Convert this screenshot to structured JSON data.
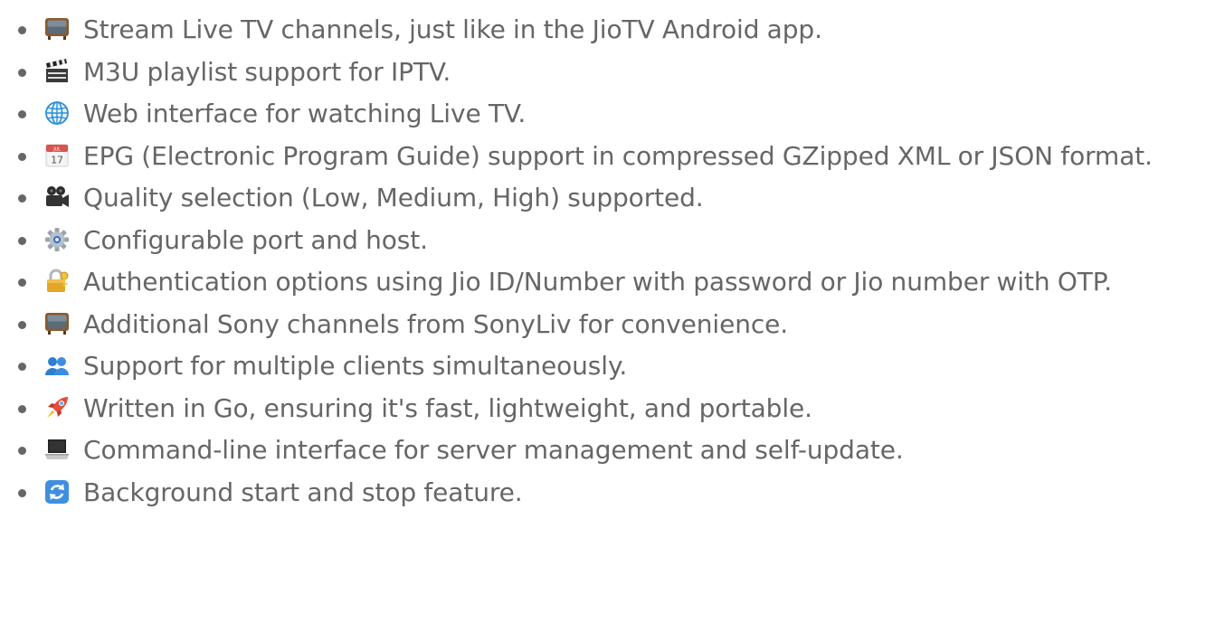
{
  "features": [
    {
      "icon": "television-icon",
      "text": "Stream Live TV channels, just like in the JioTV Android app."
    },
    {
      "icon": "clapper-board-icon",
      "text": "M3U playlist support for IPTV."
    },
    {
      "icon": "globe-icon",
      "text": "Web interface for watching Live TV."
    },
    {
      "icon": "calendar-icon",
      "text": "EPG (Electronic Program Guide) support in compressed GZipped XML or JSON format."
    },
    {
      "icon": "movie-camera-icon",
      "text": "Quality selection (Low, Medium, High) supported."
    },
    {
      "icon": "gear-icon",
      "text": "Configurable port and host."
    },
    {
      "icon": "lock-key-icon",
      "text": "Authentication options using Jio ID/Number with password or Jio number with OTP."
    },
    {
      "icon": "television-icon",
      "text": "Additional Sony channels from SonyLiv for convenience."
    },
    {
      "icon": "busts-icon",
      "text": "Support for multiple clients simultaneously."
    },
    {
      "icon": "rocket-icon",
      "text": "Written in Go, ensuring it's fast, lightweight, and portable."
    },
    {
      "icon": "laptop-icon",
      "text": "Command-line interface for server management and self-update."
    },
    {
      "icon": "refresh-icon",
      "text": "Background start and stop feature."
    }
  ],
  "calendar_day": "17",
  "calendar_month": "JUL"
}
